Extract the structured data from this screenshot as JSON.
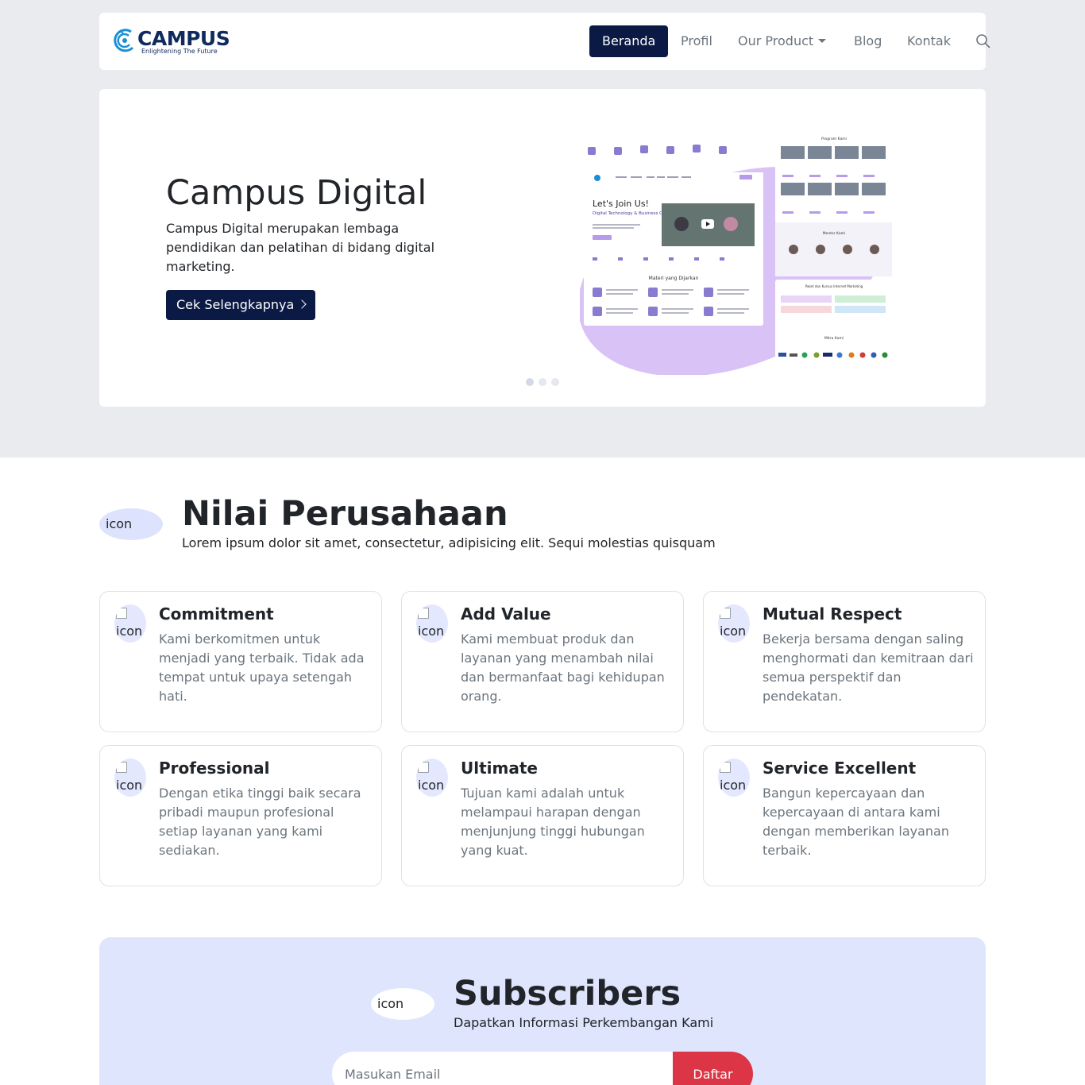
{
  "brand": {
    "name": "CAMPUS",
    "tagline": "Enlightening The Future"
  },
  "nav": {
    "items": [
      "Beranda",
      "Profil",
      "Our Product",
      "Blog",
      "Kontak"
    ],
    "active": "Beranda",
    "search_icon": "search-icon"
  },
  "hero": {
    "title": "Campus Digital",
    "description": "Campus Digital merupakan lembaga pendidikan dan pelatihan di bidang digital marketing.",
    "cta_label": "Cek Selengkapnya",
    "slides": 3,
    "active_slide": 1,
    "mockup": {
      "join_title": "Let's Join Us!",
      "join_sub": "Digital Technology & Business Class",
      "materi_title": "Materi yang Dijarkan",
      "program_title": "Program Kami",
      "mentor_title": "Mentor Kami",
      "paket_title": "Paket dan Kursus Internet Marketing",
      "mitra_title": "Mitra Kami"
    }
  },
  "values": {
    "icon_alt": "icon",
    "title": "Nilai Perusahaan",
    "subtitle": "Lorem ipsum dolor sit amet, consectetur, adipisicing elit. Sequi molestias quisquam",
    "cards": [
      {
        "icon_alt": "icon",
        "title": "Commitment",
        "text": "Kami berkomitmen untuk menjadi yang terbaik. Tidak ada tempat untuk upaya setengah hati."
      },
      {
        "icon_alt": "icon",
        "title": "Add Value",
        "text": "Kami membuat produk dan layanan yang menambah nilai dan bermanfaat bagi kehidupan orang."
      },
      {
        "icon_alt": "icon",
        "title": "Mutual Respect",
        "text": "Bekerja bersama dengan saling menghormati dan kemitraan dari semua perspektif dan pendekatan."
      },
      {
        "icon_alt": "icon",
        "title": "Professional",
        "text": "Dengan etika tinggi baik secara pribadi maupun profesional setiap layanan yang kami sediakan."
      },
      {
        "icon_alt": "icon",
        "title": "Ultimate",
        "text": "Tujuan kami adalah untuk melampaui harapan dengan menjunjung tinggi hubungan yang kuat."
      },
      {
        "icon_alt": "icon",
        "title": "Service Excellent",
        "text": "Bangun kepercayaan dan kepercayaan di antara kami dengan memberikan layanan terbaik."
      }
    ]
  },
  "subscribers": {
    "icon_alt": "icon",
    "title": "Subscribers",
    "subtitle": "Dapatkan Informasi Perkembangan Kami",
    "email_placeholder": "Masukan Email",
    "button_label": "Daftar"
  },
  "colors": {
    "primary": "#0b1a44",
    "danger": "#dc3545",
    "page_band": "#e9ebef",
    "subscribe_bg": "#dfe5fd",
    "mockup_blob": "#d9c2f5"
  }
}
